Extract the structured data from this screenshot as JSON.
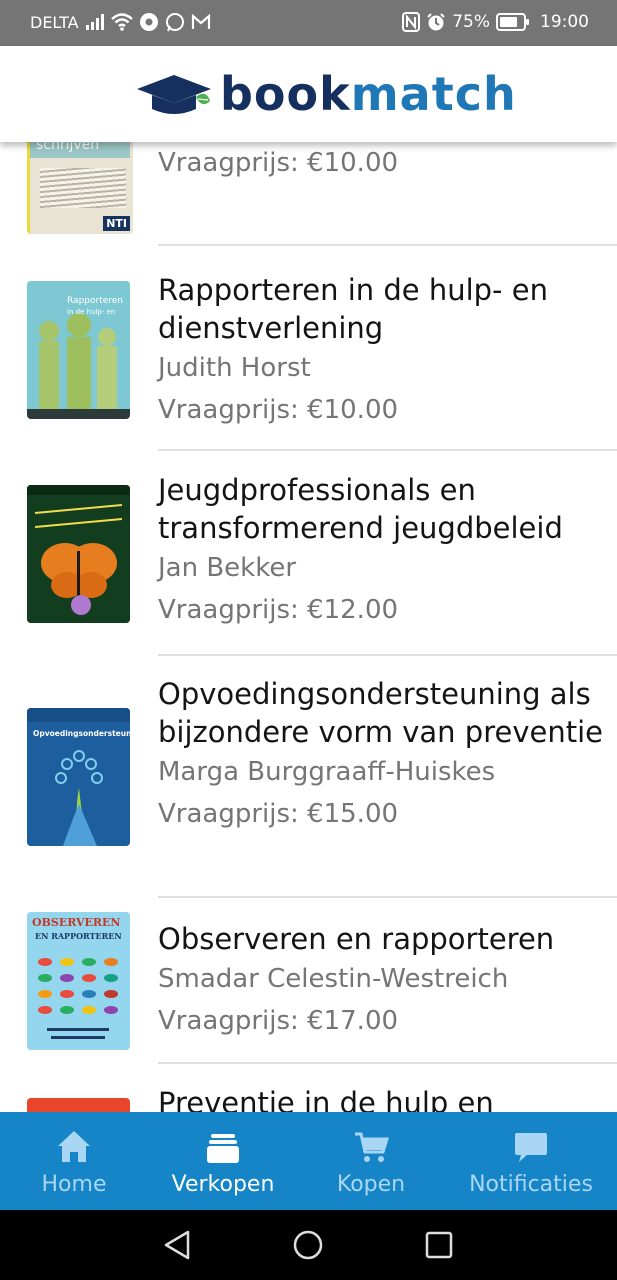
{
  "status_bar": {
    "carrier": "DELTA",
    "battery": "75%",
    "time": "19:00"
  },
  "header": {
    "logo_part1": "book",
    "logo_part2": "match"
  },
  "books": [
    {
      "title": "",
      "author": "",
      "price": "Vraagprijs: €10.00",
      "cover_text": "schrijven",
      "cover_badge": "NTI"
    },
    {
      "title": "Rapporteren in de hulp- en dienstverlening",
      "author": "Judith Horst",
      "price": "Vraagprijs: €10.00"
    },
    {
      "title": "Jeugdprofessionals en transformerend jeugdbeleid",
      "author": "Jan Bekker",
      "price": "Vraagprijs: €12.00"
    },
    {
      "title": "Opvoedingsondersteuning als bijzondere vorm van preventie",
      "author": "Marga Burggraaff-Huiskes",
      "price": "Vraagprijs: €15.00"
    },
    {
      "title": "Observeren en rapporteren",
      "author": "Smadar Celestin-Westreich",
      "price": "Vraagprijs: €17.00"
    },
    {
      "title": "Preventie in de hulp en",
      "author": "",
      "price": ""
    }
  ],
  "bottom_nav": {
    "items": [
      {
        "label": "Home",
        "icon": "home-icon"
      },
      {
        "label": "Verkopen",
        "icon": "sell-icon"
      },
      {
        "label": "Kopen",
        "icon": "cart-icon"
      },
      {
        "label": "Notificaties",
        "icon": "chat-bubble-icon"
      }
    ],
    "active": "Verkopen"
  },
  "colors": {
    "brand_dark": "#152f5e",
    "brand_blue": "#1f77b6",
    "nav_background": "#1585c8",
    "status_bar": "#757575"
  }
}
